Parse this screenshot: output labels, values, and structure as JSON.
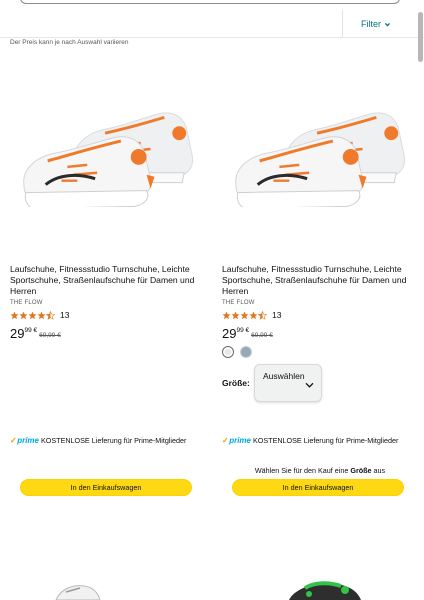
{
  "header": {
    "filter_label": "Filter"
  },
  "price_note": "Der Preis kann je nach Auswahl variieren",
  "products": [
    {
      "title": "Laufschuhe, Fitnessstudio Turnschuhe, Leichte Sportschuhe, Straßenlaufschuhe für Damen und Herren",
      "brand": "THE FLOW",
      "rating": 4.5,
      "rating_count": "13",
      "price_whole": "29",
      "price_fraction": "99 €",
      "price_old": "69,99 €",
      "delivery_prefix": "prime",
      "delivery_text": "KOSTENLOSE Lieferung für Prime-Mitglieder",
      "cart_label": "In den Einkaufswagen"
    },
    {
      "title": "Laufschuhe, Fitnessstudio Turnschuhe, Leichte Sportschuhe, Straßenlaufschuhe für Damen und Herren",
      "brand": "THE FLOW",
      "rating": 4.5,
      "rating_count": "13",
      "price_whole": "29",
      "price_fraction": "99 €",
      "price_old": "69,99 €",
      "swatches": [
        "white-grey",
        "light-blue-grey"
      ],
      "size_label": "Größe:",
      "size_value": "Auswählen",
      "delivery_prefix": "prime",
      "delivery_text": "KOSTENLOSE Lieferung für Prime-Mitglieder",
      "size_hint_pre": "Wählen Sie für den Kauf eine ",
      "size_hint_bold": "Größe",
      "size_hint_post": " aus",
      "cart_label": "In den Einkaufswagen"
    }
  ],
  "colors": {
    "link": "#007185",
    "cart_button": "#FFD814",
    "prime_blue": "#00A8E1",
    "prime_check": "#FF9900",
    "star": "#DE7921",
    "shoe_accent": "#F07A2C"
  },
  "icons": {
    "filter_chevron": "chevron-down-icon",
    "size_chevron": "chevron-down-icon",
    "star": "star-icon"
  }
}
